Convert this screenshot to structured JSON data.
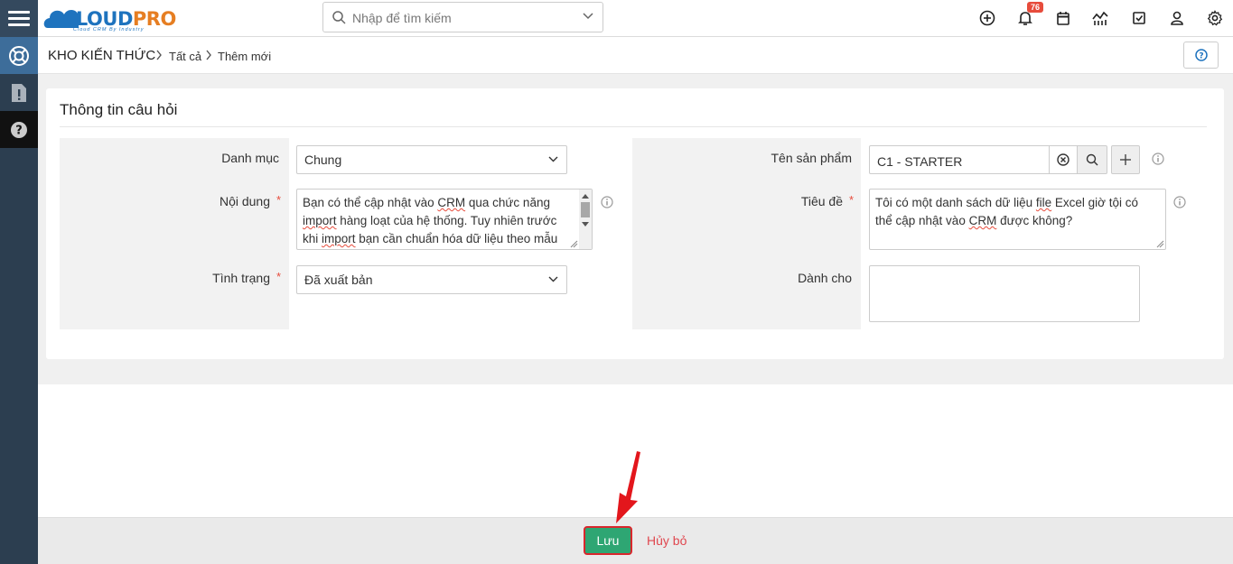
{
  "app": {
    "logo": {
      "part1": "CLOUD",
      "part2": "PRO",
      "tagline": "Cloud CRM By Industry"
    },
    "search": {
      "placeholder": "Nhập để tìm kiếm"
    },
    "notifications_count": "76",
    "toolbar_icons": [
      "plus-circle-icon",
      "bell-icon",
      "calendar-icon",
      "chart-icon",
      "checkbox-icon",
      "user-icon",
      "gear-icon"
    ]
  },
  "sidebar": {
    "items": [
      {
        "name": "knowledge-base-icon",
        "active": true
      },
      {
        "name": "report-icon",
        "active": false
      },
      {
        "name": "help-icon",
        "active": false
      }
    ]
  },
  "breadcrumb": {
    "module": "KHO KIẾN THỨC",
    "items": [
      "Tất cả",
      "Thêm mới"
    ]
  },
  "form": {
    "title": "Thông tin câu hỏi",
    "left": {
      "category": {
        "label": "Danh mục",
        "value": "Chung"
      },
      "content": {
        "label": "Nội dung",
        "required": "*",
        "lines": [
          [
            "Bạn có thể cập nhật vào ",
            "CRM",
            " qua chức năng"
          ],
          [
            "import",
            " hàng loạt của hệ thống. Tuy nhiên trước"
          ],
          [
            "khi ",
            "import",
            " bạn cần chuẩn hóa dữ liệu theo mẫu"
          ]
        ]
      },
      "status": {
        "label": "Tình trạng",
        "required": "*",
        "value": "Đã xuất bản"
      }
    },
    "right": {
      "product": {
        "label": "Tên sản phẩm",
        "value": "C1 - STARTER"
      },
      "subject": {
        "label": "Tiêu đề",
        "required": "*",
        "lines": [
          [
            "Tôi có một danh sách dữ liệu ",
            "file",
            " Excel giờ tội có"
          ],
          [
            "thể cập nhật vào ",
            "CRM",
            " được không?"
          ]
        ]
      },
      "audience": {
        "label": "Dành cho",
        "value": ""
      }
    }
  },
  "footer": {
    "save_label": "Lưu",
    "cancel_label": "Hủy bỏ"
  },
  "colors": {
    "sidebar": "#2c3e50",
    "save": "#2ea673",
    "cancel": "#e0474f",
    "required": "#e74c3c",
    "highlight_arrow": "#e3161c"
  }
}
